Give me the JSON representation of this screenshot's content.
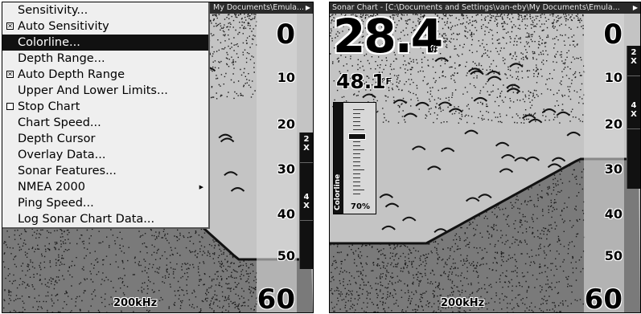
{
  "left": {
    "title": "My Documents\\Emula...",
    "frequency": "200kHz",
    "depth_scale": [
      "0",
      "10",
      "20",
      "30",
      "40",
      "50",
      "60"
    ],
    "zoom": [
      "2X",
      "4X"
    ],
    "menu": [
      {
        "label": "Sensitivity...",
        "check": null,
        "selected": false,
        "submenu": false
      },
      {
        "label": "Auto Sensitivity",
        "check": "checked",
        "selected": false,
        "submenu": false
      },
      {
        "label": "Colorline...",
        "check": null,
        "selected": true,
        "submenu": false
      },
      {
        "label": "Depth Range...",
        "check": null,
        "selected": false,
        "submenu": false
      },
      {
        "label": "Auto Depth Range",
        "check": "checked",
        "selected": false,
        "submenu": false
      },
      {
        "label": "Upper And Lower Limits...",
        "check": null,
        "selected": false,
        "submenu": false
      },
      {
        "label": "Stop Chart",
        "check": "unchecked",
        "selected": false,
        "submenu": false
      },
      {
        "label": "Chart Speed...",
        "check": null,
        "selected": false,
        "submenu": false
      },
      {
        "label": "Depth Cursor",
        "check": null,
        "selected": false,
        "submenu": false
      },
      {
        "label": "Overlay Data...",
        "check": null,
        "selected": false,
        "submenu": false
      },
      {
        "label": "Sonar Features...",
        "check": null,
        "selected": false,
        "submenu": false
      },
      {
        "label": "NMEA 2000",
        "check": null,
        "selected": false,
        "submenu": true
      },
      {
        "label": "Ping Speed...",
        "check": null,
        "selected": false,
        "submenu": false
      },
      {
        "label": "Log Sonar Chart Data...",
        "check": null,
        "selected": false,
        "submenu": false
      }
    ]
  },
  "right": {
    "title": "Sonar Chart - [C:\\Documents and Settings\\van-eby\\My Documents\\Emula...",
    "frequency": "200kHz",
    "depth_scale": [
      "0",
      "10",
      "20",
      "30",
      "40",
      "50",
      "60"
    ],
    "zoom": [
      "2X",
      "4X"
    ],
    "depth_value": "28.4",
    "depth_unit": "ft",
    "temp_value": "48.1",
    "temp_unit": "°F",
    "colorline_label": "Colorline",
    "colorline_value": "70%",
    "colorline_level": 0.7
  },
  "icons": {
    "title_arrow": "▶",
    "submenu_arrow": "▶",
    "check_mark": "✕"
  },
  "colors": {
    "menu_bg": "#efefef",
    "menu_selected": "#111111",
    "sonar_bg": "#b8b8b8",
    "titlebar": "#2a2a2a"
  }
}
